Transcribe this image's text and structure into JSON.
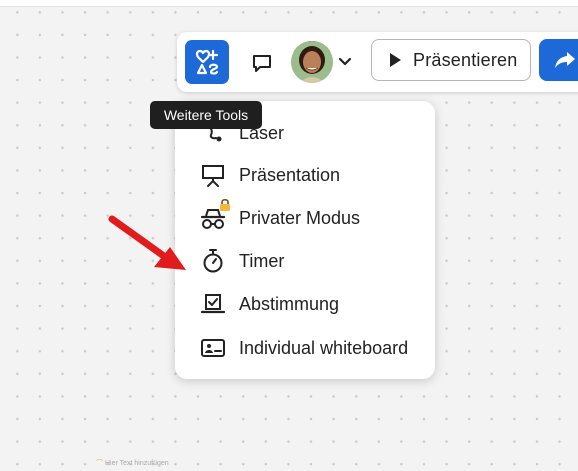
{
  "toolbar": {
    "tools_icon": "shapes-icon",
    "comment_icon": "comment-icon",
    "avatar_icon": "user-avatar",
    "chevron_icon": "chevron-down-icon",
    "present_label": "Präsentieren",
    "share_icon": "share-arrow-icon",
    "accent_color": "#1d69d8"
  },
  "tooltip": {
    "text": "Weitere Tools"
  },
  "menu": {
    "items": [
      {
        "label": "Laser",
        "icon": "laser-icon"
      },
      {
        "label": "Präsentation",
        "icon": "presentation-icon"
      },
      {
        "label": "Privater Modus",
        "icon": "private-mode-icon"
      },
      {
        "label": "Timer",
        "icon": "stopwatch-icon"
      },
      {
        "label": "Abstimmung",
        "icon": "voting-icon"
      },
      {
        "label": "Individual whiteboard",
        "icon": "individual-whiteboard-icon"
      }
    ]
  },
  "canvas": {
    "note_text": "Hier Text hinzufügen"
  },
  "annotation": {
    "arrow_color": "#e01c1c"
  }
}
